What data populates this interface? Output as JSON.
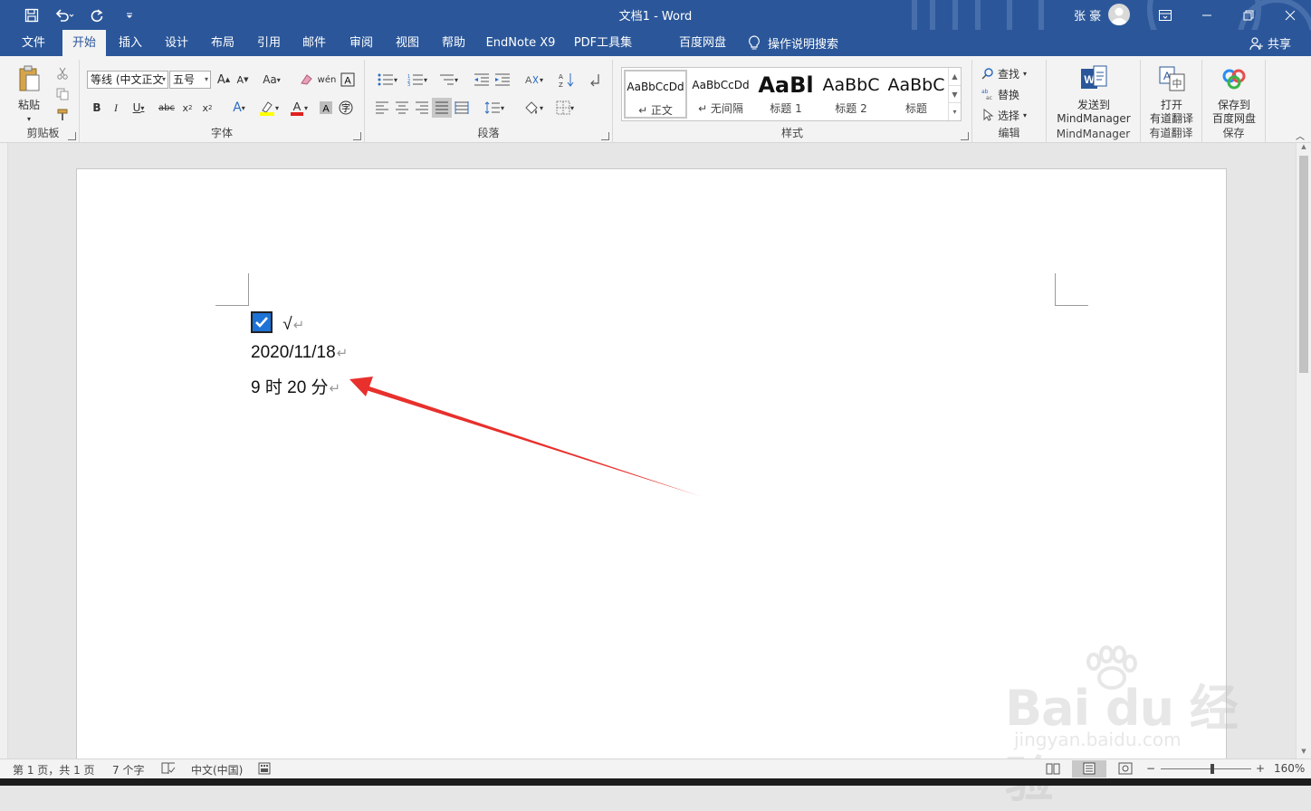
{
  "window": {
    "title": "文档1  -  Word",
    "user_name": "张 豪",
    "accent_color": "#2b579a"
  },
  "qat": {
    "save_icon": "save-icon",
    "undo_icon": "undo-icon",
    "redo_icon": "redo-icon",
    "customize_icon": "customize-qat-icon"
  },
  "tabs": [
    {
      "label": "文件"
    },
    {
      "label": "开始"
    },
    {
      "label": "插入"
    },
    {
      "label": "设计"
    },
    {
      "label": "布局"
    },
    {
      "label": "引用"
    },
    {
      "label": "邮件"
    },
    {
      "label": "审阅"
    },
    {
      "label": "视图"
    },
    {
      "label": "帮助"
    },
    {
      "label": "EndNote X9"
    },
    {
      "label": "PDF工具集"
    },
    {
      "label": "百度网盘"
    }
  ],
  "active_tab": "开始",
  "tell_me": "操作说明搜索",
  "share": "共享",
  "ribbon": {
    "clipboard": {
      "label": "剪贴板",
      "paste": "粘贴"
    },
    "font": {
      "label": "字体",
      "font_name": "等线 (中文正文",
      "font_size": "五号"
    },
    "paragraph": {
      "label": "段落"
    },
    "styles": {
      "label": "样式",
      "items": [
        {
          "sample": "AaBbCcDd",
          "name": "↵ 正文"
        },
        {
          "sample": "AaBbCcDd",
          "name": "↵ 无间隔"
        },
        {
          "sample": "AaBl",
          "name": "标题 1"
        },
        {
          "sample": "AaBbC",
          "name": "标题 2"
        },
        {
          "sample": "AaBbC",
          "name": "标题"
        }
      ]
    },
    "editing": {
      "label": "编辑",
      "find": "查找",
      "replace": "替换",
      "select": "选择"
    },
    "mindmanager": {
      "line1": "发送到",
      "line2": "MindManager",
      "group": "MindManager"
    },
    "youdao": {
      "line1": "打开",
      "line2": "有道翻译",
      "group": "有道翻译"
    },
    "baidu": {
      "line1": "保存到",
      "line2": "百度网盘",
      "group": "保存"
    }
  },
  "document": {
    "line1_symbol": "√",
    "line2": "2020/11/18",
    "line3": "9 时 20 分",
    "para_mark": "↵",
    "checkbox_checked": true
  },
  "watermark": {
    "text": "Bai du 经验",
    "url": "jingyan.baidu.com"
  },
  "status": {
    "page": "第 1 页，共 1 页",
    "words": "7 个字",
    "language": "中文(中国)",
    "zoom": "160%"
  }
}
